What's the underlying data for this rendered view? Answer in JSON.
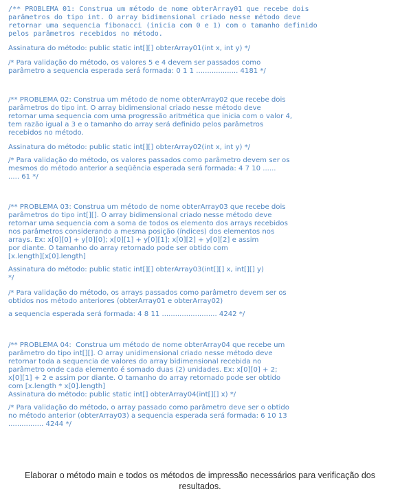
{
  "problem_01": {
    "lines": [
      "/** PROBLEMA 01: Construa um método de nome obterArray01 que recebe dois",
      "parâmetros do tipo int. O array bidimensional criado nesse método deve",
      "retornar uma sequencia fibonacci (inicia com 0 e 1) com o tamanho definido",
      "pelos parâmetros recebidos no método."
    ],
    "signature": "Assinatura do método: public static int[][] obterArray01(int x, int y) */",
    "validation": [
      "/* Para validação do método, os valores 5 e 4 devem ser passados como",
      "parâmetro a sequencia esperada será formada: 0 1 1 ................... 4181 */"
    ]
  },
  "problem_02": {
    "lines": [
      "/** PROBLEMA 02: Construa um método de nome obterArray02 que recebe dois",
      "parâmetros do tipo int. O array bidimensional criado nesse método deve",
      "retornar uma sequencia com uma progressão aritmética que inicia com o valor 4,",
      "tem razão igual a 3 e o tamanho do array será definido pelos parâmetros",
      "recebidos no método."
    ],
    "signature": "Assinatura do método: public static int[][] obterArray02(int x, int y) */",
    "validation": [
      "/* Para validação do método, os valores passados como parâmetro devem ser os",
      "mesmos do método anterior a seqüência esperada será formada: 4 7 10 ......",
      "..... 61 */"
    ]
  },
  "problem_03": {
    "lines": [
      "/** PROBLEMA 03: Construa um método de nome obterArray03 que recebe dois",
      "parâmetros do tipo int[][]. O array bidimensional criado nesse método deve",
      "retornar uma sequencia com a soma de todos os elemento dos arrays recebidos",
      "nos parâmetros considerando a mesma posição (índices) dos elementos nos",
      "arrays. Ex: x[0][0] + y[0][0]; x[0][1] + y[0][1]; x[0][2] + y[0][2] e assim",
      "por diante. O tamanho do array retornado pode ser obtido com",
      "[x.length][x[0].length]"
    ],
    "signature": [
      "Assinatura do método: public static int[][] obterArray03(int[][] x, int[][] y)",
      "*/"
    ],
    "validation": [
      "/* Para validação do método, os arrays passados como parâmetro devem ser os",
      "obtidos nos método anteriores (obterArray01 e obterArray02)",
      "a sequencia esperada será formada: 4 8 11 ......................... 4242 */"
    ]
  },
  "problem_04": {
    "lines": [
      "/** PROBLEMA 04:  Construa um método de nome obterArray04 que recebe um",
      "parâmetro do tipo int[][]. O array unidimensional criado nesse método deve",
      "retornar toda a sequencia de valores do array bidimensional recebida no",
      "parâmetro onde cada elemento é somado duas (2) unidades. Ex: x[0][0] + 2;",
      "x[0][1] + 2 e assim por diante. O tamanho do array retornado pode ser obtido",
      "com [x.length * x[0].length]"
    ],
    "signature": "Assinatura do método: public static int[] obterArray04(int[][] x) */",
    "validation": [
      "/* Para validação do método, o array passado como parâmetro deve ser o obtido",
      "no método anterior (obterArray03) a sequencia esperada será formada: 6 10 13",
      "................ 4244 */"
    ]
  },
  "caption": [
    "Elaborar o método main e todos os métodos de impressão necessários para verificação dos",
    "resultados."
  ]
}
